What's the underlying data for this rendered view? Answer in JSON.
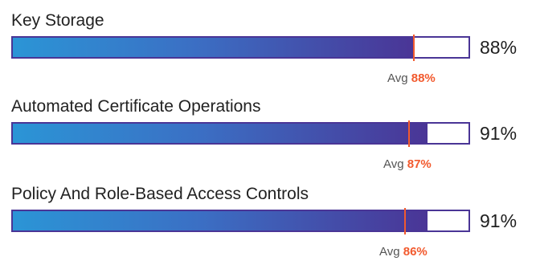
{
  "colors": {
    "bar_gradient_start": "#2b95d6",
    "bar_gradient_end": "#4a3596",
    "track_border": "#4a3596",
    "avg_marker": "#f25a2e"
  },
  "metrics": [
    {
      "label": "Key Storage",
      "value_text": "88%",
      "value": 88,
      "avg_label": "Avg",
      "avg_value_text": "88%",
      "avg_value": 88
    },
    {
      "label": "Automated Certificate Operations",
      "value_text": "91%",
      "value": 91,
      "avg_label": "Avg",
      "avg_value_text": "87%",
      "avg_value": 87
    },
    {
      "label": "Policy And Role-Based Access Controls",
      "value_text": "91%",
      "value": 91,
      "avg_label": "Avg",
      "avg_value_text": "86%",
      "avg_value": 86
    }
  ]
}
